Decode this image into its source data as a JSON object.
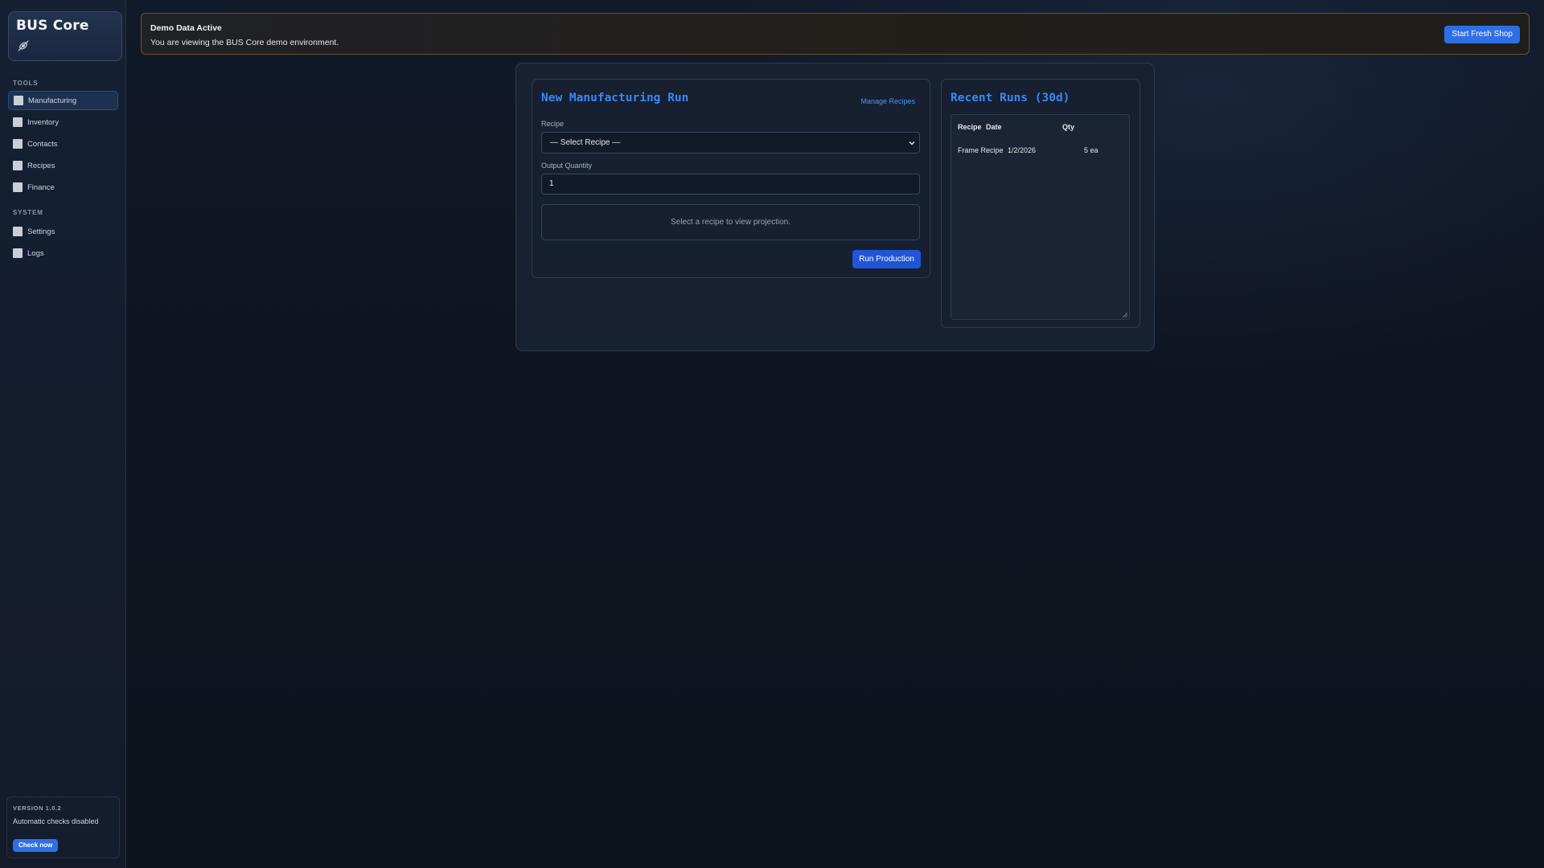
{
  "sidebar": {
    "brand": {
      "title": "BUS Core",
      "icon": "satellite-icon"
    },
    "sections": [
      {
        "label": "TOOLS"
      },
      {
        "label": "SYSTEM"
      }
    ],
    "tools_items": [
      {
        "label": "Manufacturing",
        "active": true
      },
      {
        "label": "Inventory"
      },
      {
        "label": "Contacts"
      },
      {
        "label": "Recipes"
      },
      {
        "label": "Finance"
      }
    ],
    "system_items": [
      {
        "label": "Settings"
      },
      {
        "label": "Logs"
      }
    ],
    "version": {
      "label": "VERSION 1.0.2",
      "status": "Automatic checks disabled",
      "check_button": "Check now"
    }
  },
  "banner": {
    "title": "Demo Data Active",
    "text": "You are viewing the BUS Core demo environment.",
    "button": "Start Fresh Shop"
  },
  "new_run": {
    "title": "New Manufacturing Run",
    "manage_link": "Manage Recipes",
    "recipe_label": "Recipe",
    "recipe_selected": "— Select Recipe —",
    "quantity_label": "Output Quantity",
    "quantity_value": "1",
    "projection_text": "Select a recipe to view projection.",
    "run_button": "Run Production"
  },
  "recent_runs": {
    "title": "Recent Runs (30d)",
    "columns": [
      "Recipe",
      "Date",
      "Qty"
    ],
    "rows": [
      {
        "recipe": "Frame Recipe",
        "date": "1/2/2026",
        "qty": "5 ea"
      }
    ]
  },
  "colors": {
    "accent": "#3d86f5",
    "primary_button": "#2f6fe6",
    "banner_border": "#6a5430"
  }
}
